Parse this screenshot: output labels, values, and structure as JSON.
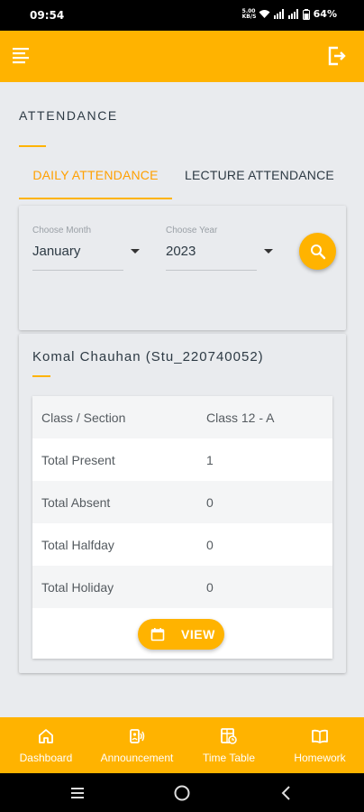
{
  "status_bar": {
    "time": "09:54",
    "speed_top": "5.00",
    "speed_bottom": "KB/S",
    "battery": "64%"
  },
  "header": {
    "title": "ATTENDANCE"
  },
  "tabs": [
    {
      "label": "DAILY ATTENDANCE",
      "active": true
    },
    {
      "label": "LECTURE ATTENDANCE",
      "active": false
    }
  ],
  "filters": {
    "month": {
      "label": "Choose Month",
      "value": "January"
    },
    "year": {
      "label": "Choose Year",
      "value": "2023"
    }
  },
  "student": {
    "name": "Komal Chauhan (Stu_220740052)",
    "rows": [
      {
        "label": "Class / Section",
        "value": "Class 12 - A"
      },
      {
        "label": "Total Present",
        "value": "1"
      },
      {
        "label": "Total Absent",
        "value": "0"
      },
      {
        "label": "Total Halfday",
        "value": "0"
      },
      {
        "label": "Total Holiday",
        "value": "0"
      }
    ],
    "view_label": "VIEW"
  },
  "bottom_nav": [
    {
      "label": "Dashboard",
      "icon": "home-icon"
    },
    {
      "label": "Announcement",
      "icon": "announcement-icon"
    },
    {
      "label": "Time Table",
      "icon": "timetable-icon"
    },
    {
      "label": "Homework",
      "icon": "book-icon"
    }
  ],
  "colors": {
    "accent": "#ffb300",
    "tab_active": "#ffa000",
    "background": "#e9ebee"
  }
}
